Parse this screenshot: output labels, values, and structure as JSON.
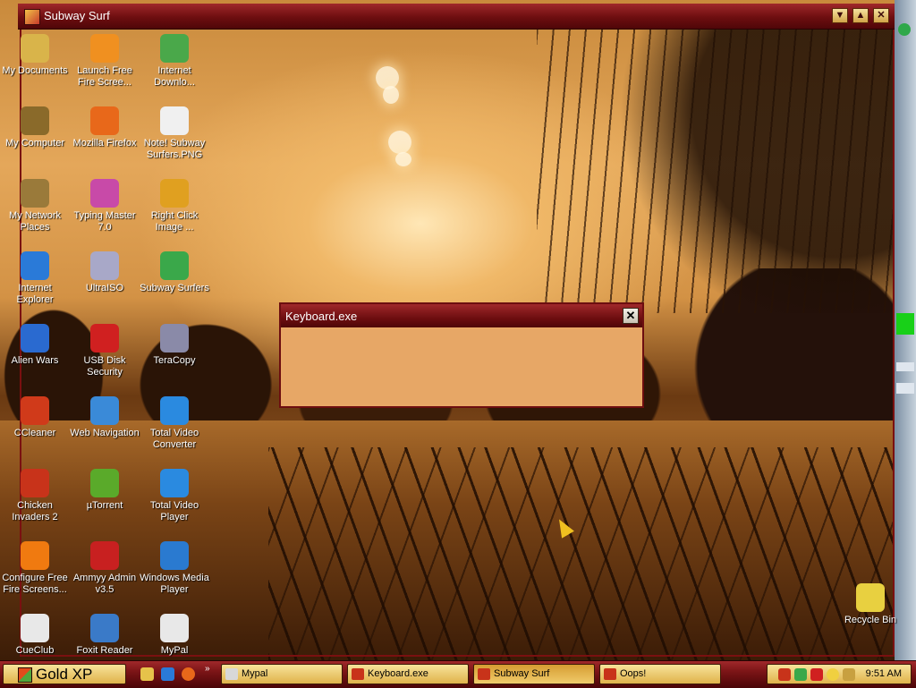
{
  "window": {
    "title": "Subway Surf"
  },
  "titlebar_buttons": [
    "minimize",
    "maximize",
    "close"
  ],
  "desktop_icons": [
    {
      "label": "My Documents",
      "icon": "folder-icon",
      "color": "#d9b44a"
    },
    {
      "label": "My Computer",
      "icon": "computer-icon",
      "color": "#8a6a2a"
    },
    {
      "label": "My Network Places",
      "icon": "network-icon",
      "color": "#9a7a3a"
    },
    {
      "label": "Internet Explorer",
      "icon": "ie-icon",
      "color": "#2a7ad8"
    },
    {
      "label": "Alien Wars",
      "icon": "alien-wars-icon",
      "color": "#2a6ad0"
    },
    {
      "label": "CCleaner",
      "icon": "ccleaner-icon",
      "color": "#d03a1a"
    },
    {
      "label": "Chicken Invaders 2",
      "icon": "chicken-icon",
      "color": "#c8331a"
    },
    {
      "label": "Configure Free Fire Screens...",
      "icon": "fire-icon",
      "color": "#f07a10"
    },
    {
      "label": "CueClub",
      "icon": "cueclub-icon",
      "color": "#e8e8e8"
    },
    {
      "label": "Launch Free Fire Scree...",
      "icon": "fire-launch-icon",
      "color": "#f09020"
    },
    {
      "label": "Mozilla Firefox",
      "icon": "firefox-icon",
      "color": "#e8681a"
    },
    {
      "label": "Typing Master 7.0",
      "icon": "typing-master-icon",
      "color": "#c84aa8"
    },
    {
      "label": "UltraISO",
      "icon": "ultraiso-icon",
      "color": "#a8a8c8"
    },
    {
      "label": "USB Disk Security",
      "icon": "shield-icon",
      "color": "#d02020"
    },
    {
      "label": "Web Navigation",
      "icon": "globe-icon",
      "color": "#3a8ad8"
    },
    {
      "label": "µTorrent",
      "icon": "utorrent-icon",
      "color": "#5aaa2a"
    },
    {
      "label": "Ammyy Admin v3.5",
      "icon": "ammyy-icon",
      "color": "#c82020"
    },
    {
      "label": "Foxit Reader",
      "icon": "foxit-icon",
      "color": "#3a7ac8"
    },
    {
      "label": "Internet Downlo...",
      "icon": "idm-icon",
      "color": "#4aa84a"
    },
    {
      "label": "Note! Subway Surfers.PNG",
      "icon": "image-file-icon",
      "color": "#f0f0f0"
    },
    {
      "label": "Right Click Image ...",
      "icon": "gear-icon",
      "color": "#e0a020"
    },
    {
      "label": "Subway Surfers",
      "icon": "subway-surfers-icon",
      "color": "#3aa84a"
    },
    {
      "label": "TeraCopy",
      "icon": "teracopy-icon",
      "color": "#8a8aa8"
    },
    {
      "label": "Total Video Converter",
      "icon": "video-converter-icon",
      "color": "#2a8ae0"
    },
    {
      "label": "Total Video Player",
      "icon": "video-player-icon",
      "color": "#2a8ae0"
    },
    {
      "label": "Windows Media Player",
      "icon": "media-player-icon",
      "color": "#2a7ad0"
    },
    {
      "label": "MyPal",
      "icon": "mypal-icon",
      "color": "#e8e8e8"
    },
    {
      "label": "Recycle Bin",
      "icon": "recycle-bin-icon",
      "color": "#e8d040"
    }
  ],
  "dialog": {
    "title": "Keyboard.exe",
    "close_label": "✕"
  },
  "taskbar": {
    "start_label": "Gold XP",
    "quicklaunch_more": "»",
    "tasks": [
      {
        "label": "Mypal",
        "icon": "mypal-icon",
        "color": "#d8d8d8"
      },
      {
        "label": "Keyboard.exe",
        "icon": "app-icon",
        "color": "#c8331a"
      },
      {
        "label": "Subway Surf",
        "icon": "subway-surfers-icon",
        "color": "#c8331a",
        "active": true
      },
      {
        "label": "Oops!",
        "icon": "app-icon",
        "color": "#c8331a"
      }
    ],
    "clock": "9:51 AM"
  },
  "colors": {
    "titlebar": "#6d0e10",
    "button_gold": "#e0b24a",
    "dialog_body": "#e7a766"
  }
}
